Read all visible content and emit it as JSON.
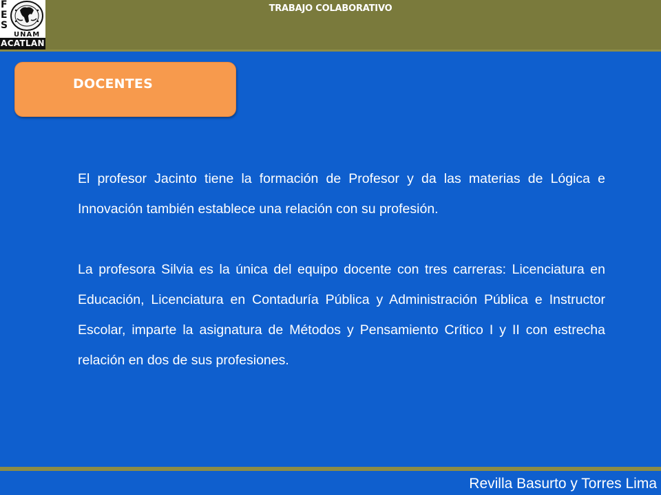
{
  "header": {
    "title": "TRABAJO COLABORATIVO"
  },
  "logo": {
    "fes_letters": [
      "F",
      "E",
      "S"
    ],
    "unam": "UNAM",
    "acatlan": "ACATLAN"
  },
  "section": {
    "title": "DOCENTES"
  },
  "paragraphs": [
    "El profesor Jacinto  tiene la formación de Profesor y da las materias de Lógica e Innovación también establece una relación con su profesión.",
    "La profesora Silvia es la única del equipo docente con tres carreras: Licenciatura en Educación, Licenciatura en Contaduría Pública y Administración Pública e Instructor Escolar, imparte la asignatura de Métodos y Pensamiento Crítico I y II con estrecha relación en dos de sus profesiones."
  ],
  "footer": {
    "authors": "Revilla Basurto y Torres Lima"
  },
  "colors": {
    "background": "#0f5fce",
    "header": "#7a7a3c",
    "section_box": "#f79a4d",
    "text": "#ffffff"
  }
}
